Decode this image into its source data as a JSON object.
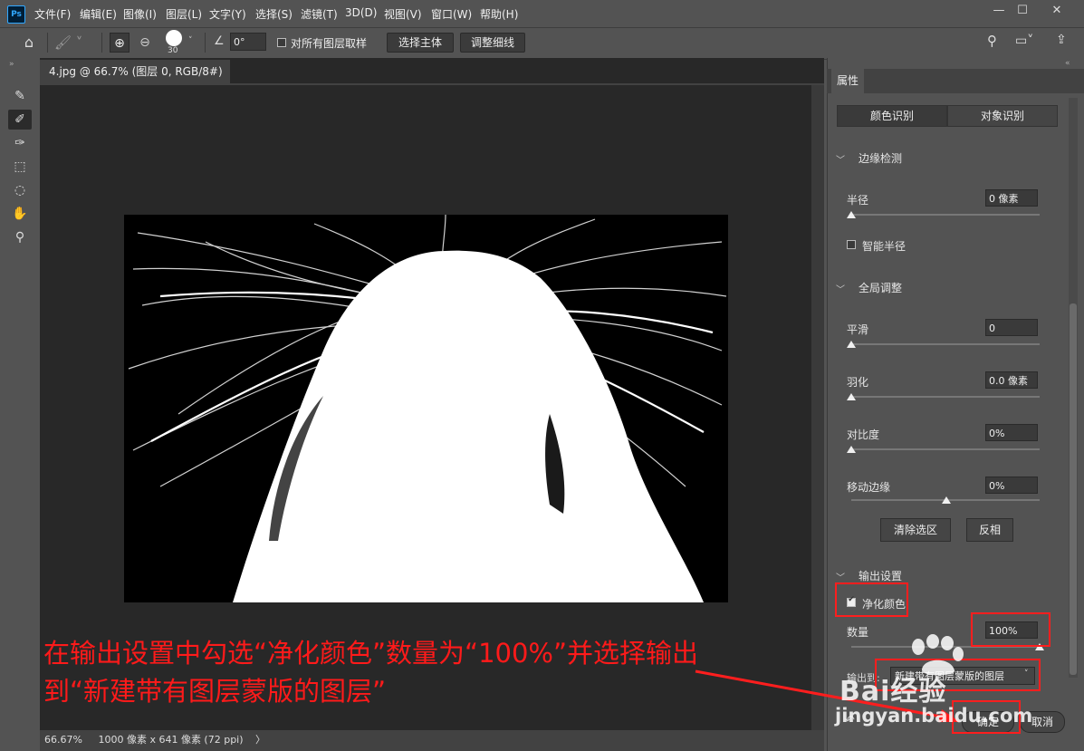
{
  "app": {
    "logo": "Ps"
  },
  "menu": [
    "文件(F)",
    "编辑(E)",
    "图像(I)",
    "图层(L)",
    "文字(Y)",
    "选择(S)",
    "滤镜(T)",
    "3D(D)",
    "视图(V)",
    "窗口(W)",
    "帮助(H)"
  ],
  "window_controls": {
    "minimize": "—",
    "maximize": "☐",
    "close": "✕"
  },
  "options": {
    "brush_size": "30",
    "angle": "0°",
    "sample_all_label": "对所有图层取样",
    "select_subject": "选择主体",
    "refine_hair": "调整细线"
  },
  "document": {
    "tab_title": "4.jpg @ 66.7% (图层 0, RGB/8#) *",
    "tab_close": "×",
    "zoom": "66.67%",
    "dimensions": "1000 像素 x 641 像素 (72 ppi)",
    "status_arrow": "〉"
  },
  "panel": {
    "tab": "属性",
    "modes": [
      "颜色识别",
      "对象识别"
    ],
    "edge_detection": {
      "title": "边缘检测",
      "radius_label": "半径",
      "radius_value": "0 像素",
      "smart_radius_label": "智能半径",
      "radius_level": 0
    },
    "global": {
      "title": "全局调整",
      "smooth_label": "平滑",
      "smooth_value": "0",
      "feather_label": "羽化",
      "feather_value": "0.0 像素",
      "contrast_label": "对比度",
      "contrast_value": "0%",
      "shift_label": "移动边缘",
      "shift_value": "0%",
      "clear_selection": "清除选区",
      "invert": "反相"
    },
    "output": {
      "title": "输出设置",
      "decontaminate_label": "净化颜色",
      "decontaminate_checked": true,
      "amount_label": "数量",
      "amount_value": "100%",
      "amount_level": 100,
      "output_to_label": "输出到:",
      "output_to_value": "新建带有图层蒙版的图层",
      "ok": "确定",
      "cancel": "取消"
    }
  },
  "annotation": {
    "line1": "在输出设置中勾选“净化颜色”数量为“100%”并选择输出",
    "line2": "到“新建带有图层蒙版的图层”"
  },
  "watermark": {
    "brand": "Bai经验",
    "url": "jingyan.baidu.com"
  },
  "colors": {
    "annotation_red": "#ff1e1e",
    "panel_bg": "#535353",
    "canvas_bg": "#282828"
  }
}
